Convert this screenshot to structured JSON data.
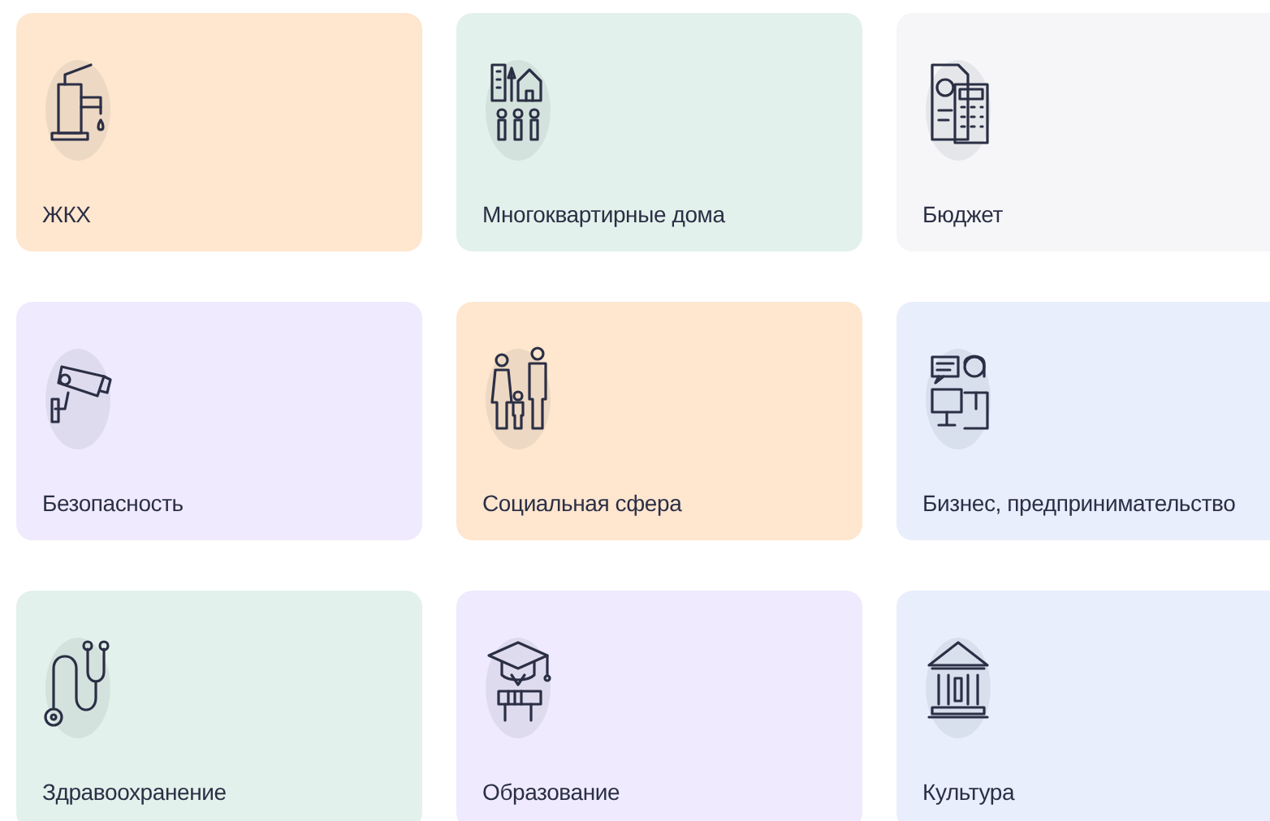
{
  "cards": [
    {
      "label": "ЖКХ",
      "color": "#fee6cf"
    },
    {
      "label": "Многоквартирные дома",
      "color": "#e2f1eb"
    },
    {
      "label": "Бюджет",
      "color": "#f6f6f8"
    },
    {
      "label": "Безопасность",
      "color": "#efeafd"
    },
    {
      "label": "Социальная сфера",
      "color": "#fee6cf"
    },
    {
      "label": "Бизнес, предпринимательство",
      "color": "#e8eefc"
    },
    {
      "label": "Здравоохранение",
      "color": "#e2f1eb"
    },
    {
      "label": "Образование",
      "color": "#efeafd"
    },
    {
      "label": "Культура",
      "color": "#e8eefc"
    }
  ]
}
